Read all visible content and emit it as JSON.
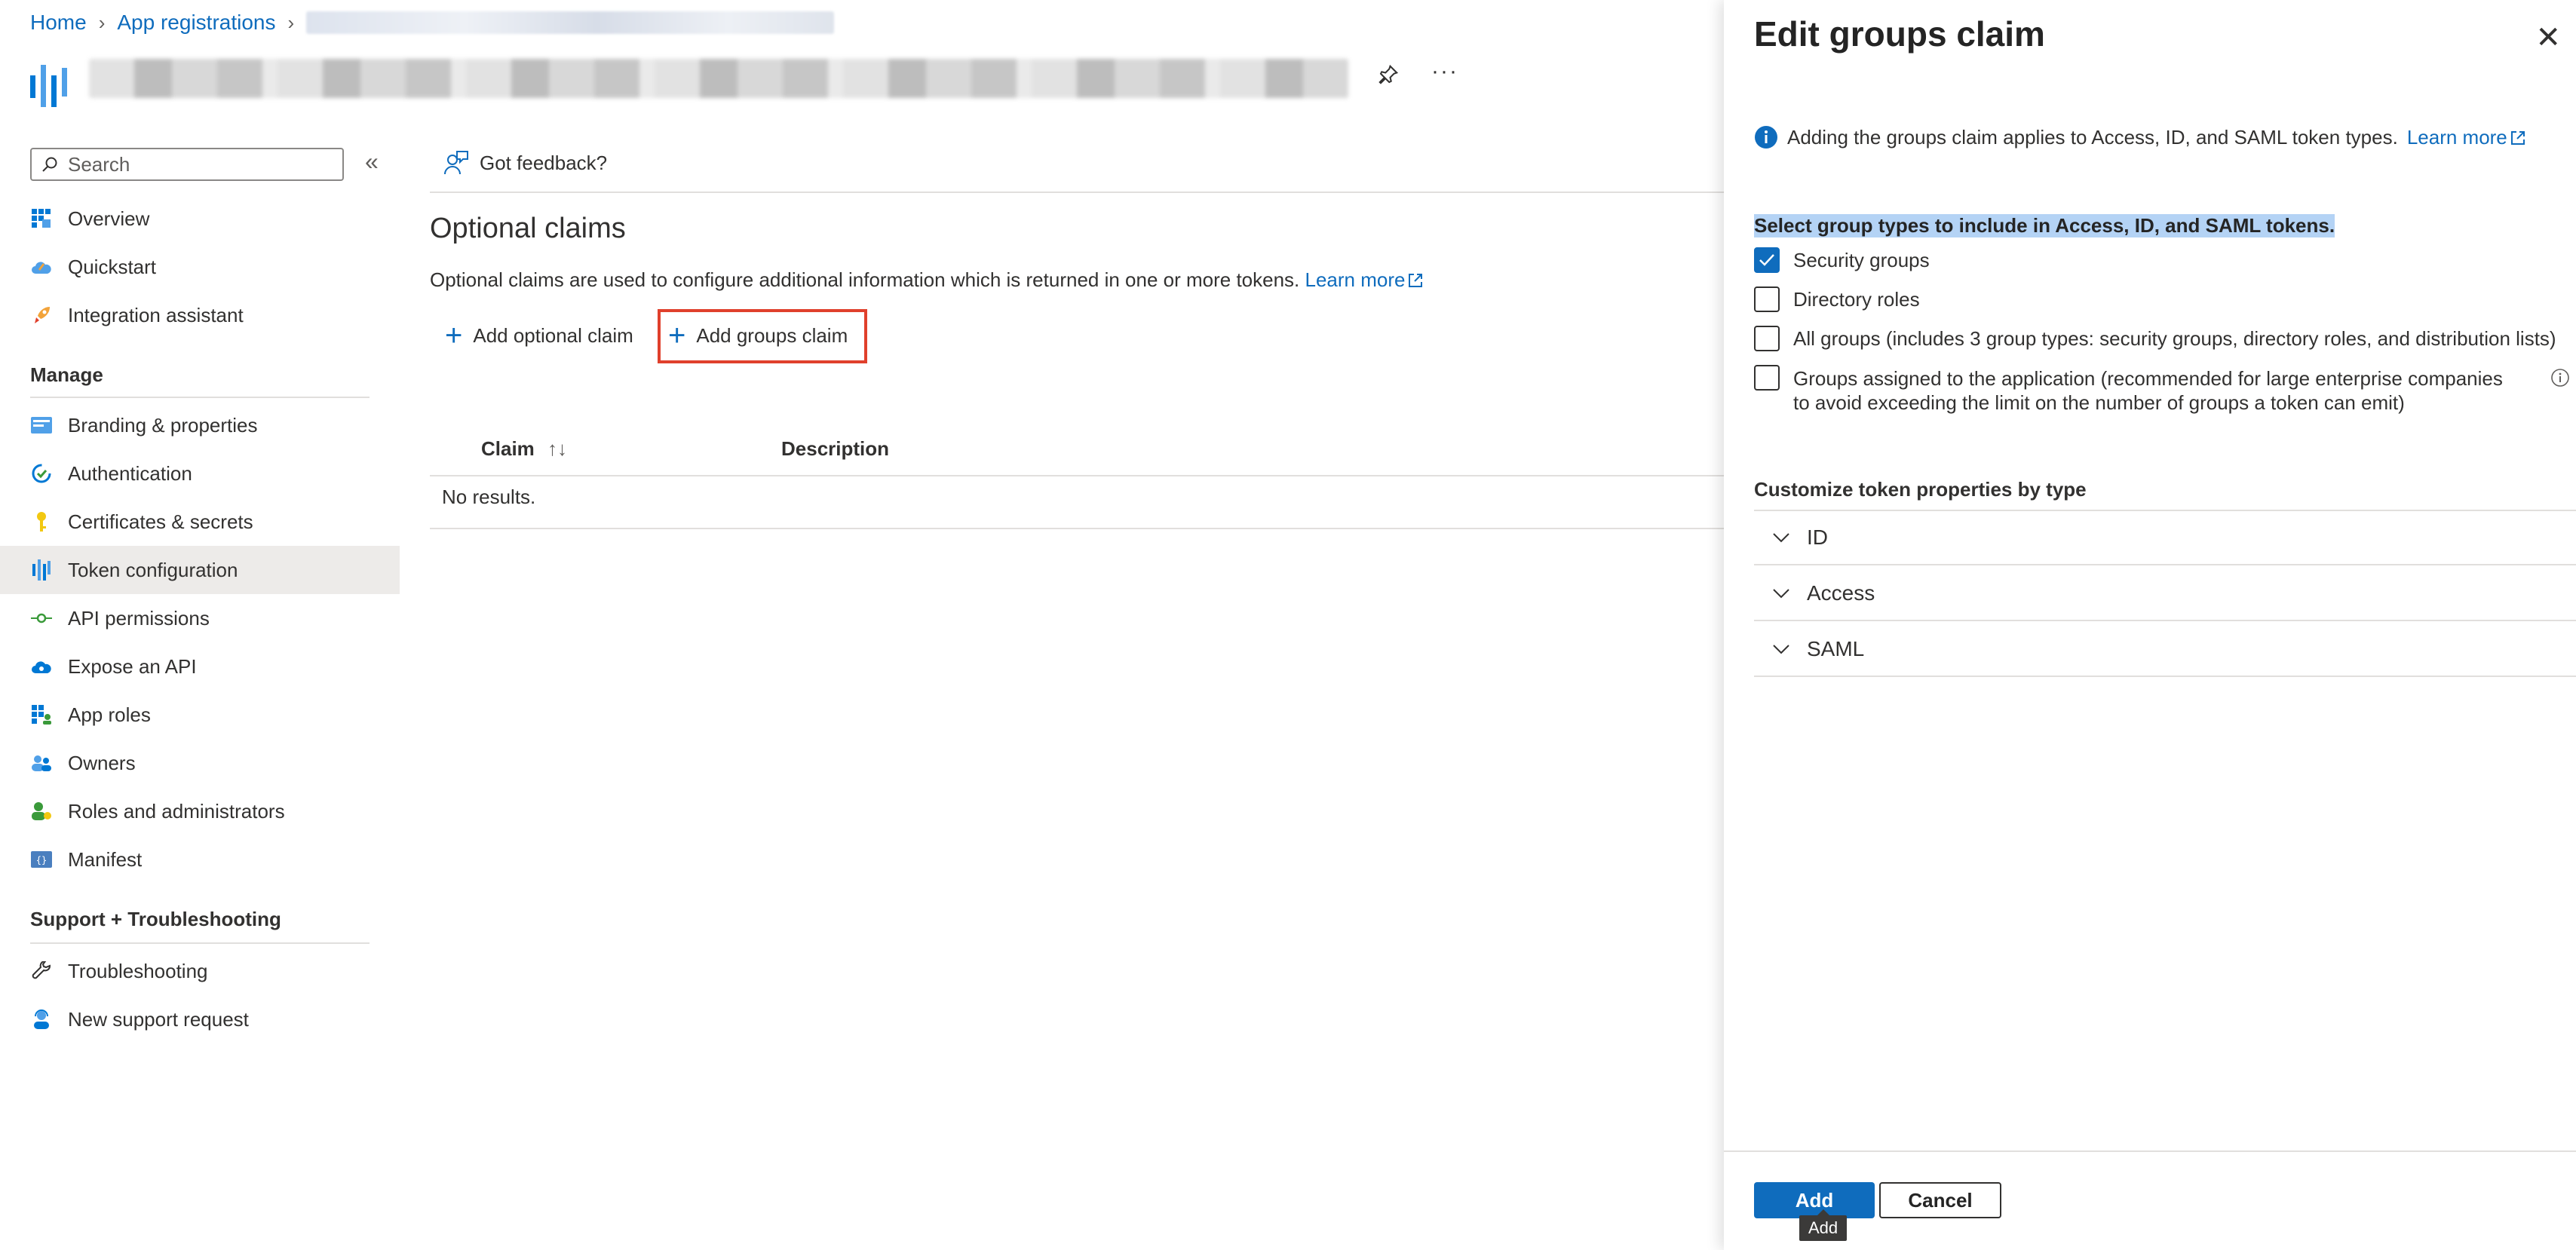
{
  "breadcrumb": {
    "home": "Home",
    "app_registrations": "App registrations"
  },
  "header": {
    "more_label": "···"
  },
  "sidebar": {
    "search_placeholder": "Search",
    "collapse_label": "«",
    "items_top": [
      {
        "label": "Overview",
        "icon": "overview-grid-icon"
      },
      {
        "label": "Quickstart",
        "icon": "cloud-rocket-icon"
      },
      {
        "label": "Integration assistant",
        "icon": "rocket-icon"
      }
    ],
    "manage_heading": "Manage",
    "items_manage": [
      {
        "label": "Branding & properties",
        "icon": "branding-icon"
      },
      {
        "label": "Authentication",
        "icon": "authentication-icon"
      },
      {
        "label": "Certificates & secrets",
        "icon": "key-icon"
      },
      {
        "label": "Token configuration",
        "icon": "token-config-icon",
        "active": true
      },
      {
        "label": "API permissions",
        "icon": "api-permissions-icon"
      },
      {
        "label": "Expose an API",
        "icon": "cloud-api-icon"
      },
      {
        "label": "App roles",
        "icon": "app-roles-icon"
      },
      {
        "label": "Owners",
        "icon": "owners-icon"
      },
      {
        "label": "Roles and administrators",
        "icon": "roles-admins-icon"
      },
      {
        "label": "Manifest",
        "icon": "manifest-icon"
      }
    ],
    "support_heading": "Support + Troubleshooting",
    "items_support": [
      {
        "label": "Troubleshooting",
        "icon": "wrench-icon"
      },
      {
        "label": "New support request",
        "icon": "support-person-icon"
      }
    ]
  },
  "main": {
    "feedback": "Got feedback?",
    "title": "Optional claims",
    "description": "Optional claims are used to configure additional information which is returned in one or more tokens.",
    "learn_more": "Learn more",
    "add_optional_claim": "Add optional claim",
    "add_groups_claim": "Add groups claim",
    "table": {
      "col_claim": "Claim",
      "sort_indicator": "↑↓",
      "col_description": "Description",
      "empty": "No results."
    }
  },
  "panel": {
    "title": "Edit groups claim",
    "close_label": "✕",
    "info_text": "Adding the groups claim applies to Access, ID, and SAML token types.",
    "info_learn_more": "Learn more",
    "select_heading": "Select group types to include in Access, ID, and SAML tokens.",
    "options": [
      {
        "label": "Security groups",
        "checked": true
      },
      {
        "label": "Directory roles",
        "checked": false
      },
      {
        "label": "All groups (includes 3 group types: security groups, directory roles, and distribution lists)",
        "checked": false
      },
      {
        "label": "Groups assigned to the application (recommended for large enterprise companies to avoid exceeding the limit on the number of groups a token can emit)",
        "checked": false
      }
    ],
    "customize_heading": "Customize token properties by type",
    "accordions": [
      {
        "label": "ID"
      },
      {
        "label": "Access"
      },
      {
        "label": "SAML"
      }
    ],
    "add_button": "Add",
    "cancel_button": "Cancel",
    "tooltip": "Add"
  },
  "colors": {
    "accent": "#0f6cbd",
    "highlight_border": "#e0402c",
    "selection": "#b4d3f5"
  }
}
